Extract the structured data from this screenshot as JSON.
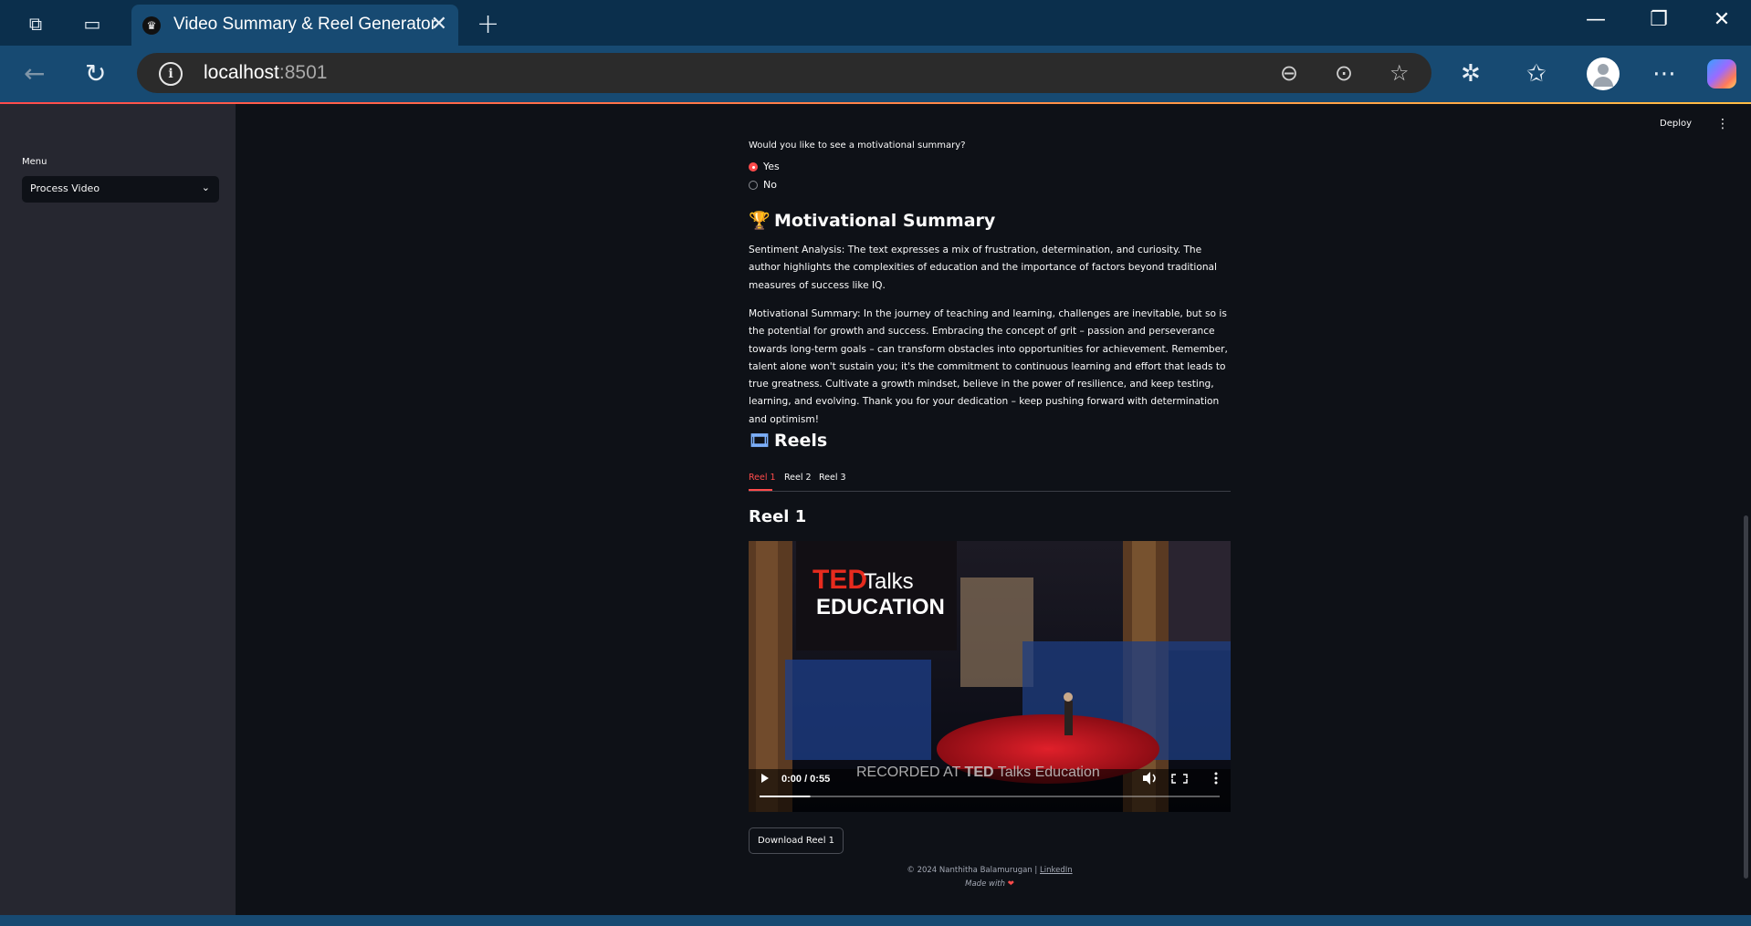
{
  "browser": {
    "tab_title": "Video Summary & Reel Generator",
    "url_host": "localhost",
    "url_port": ":8501"
  },
  "sidebar": {
    "menu_label": "Menu",
    "select_value": "Process Video"
  },
  "header": {
    "deploy_label": "Deploy"
  },
  "main": {
    "question": "Would you like to see a motivational summary?",
    "options": [
      {
        "label": "Yes",
        "selected": true
      },
      {
        "label": "No",
        "selected": false
      }
    ],
    "motivational_heading": "Motivational Summary",
    "sentiment_text": "Sentiment Analysis: The text expresses a mix of frustration, determination, and curiosity. The author highlights the complexities of education and the importance of factors beyond traditional measures of success like IQ.",
    "summary_text": "Motivational Summary: In the journey of teaching and learning, challenges are inevitable, but so is the potential for growth and success. Embracing the concept of grit – passion and perseverance towards long-term goals – can transform obstacles into opportunities for achievement. Remember, talent alone won't sustain you; it's the commitment to continuous learning and effort that leads to true greatness. Cultivate a growth mindset, believe in the power of resilience, and keep testing, learning, and evolving. Thank you for your dedication – keep pushing forward with determination and optimism!",
    "reels_heading": "Reels",
    "tabs": [
      "Reel 1",
      "Reel 2",
      "Reel 3"
    ],
    "active_tab": "Reel 1",
    "reel_title": "Reel 1",
    "video": {
      "logo_ted": "TED",
      "logo_talks": "Talks",
      "logo_education": "EDUCATION",
      "time": "0:00 / 0:55",
      "watermark_pre": "RECORDED AT ",
      "watermark_ted": "TED",
      "watermark_post": " Talks Education",
      "progress": 0.11
    },
    "download_label": "Download Reel 1"
  },
  "footer": {
    "copyright": "© 2024 Nanthitha Balamurugan | ",
    "link": "LinkedIn",
    "made_with": "Made with "
  },
  "colors": {
    "accent": "#ff4b4b",
    "background": "#0e1117",
    "sidebar": "#262730"
  }
}
